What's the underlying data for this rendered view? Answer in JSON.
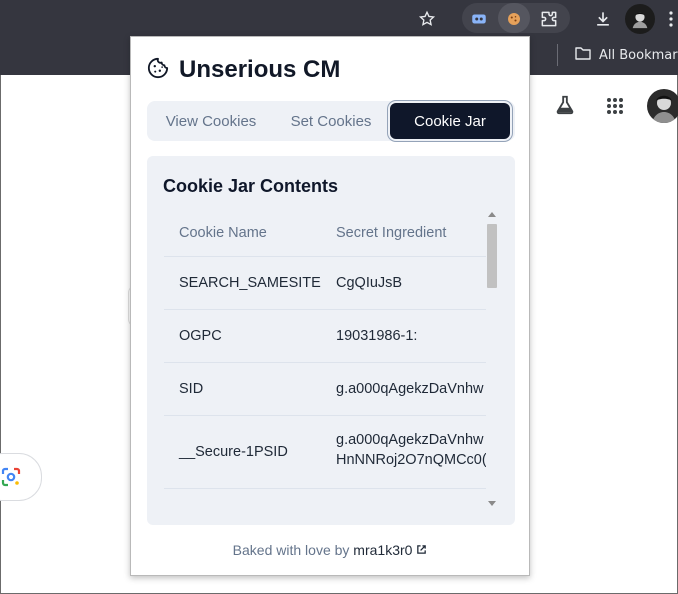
{
  "browser": {
    "bookmarks_label": "All Bookmarks"
  },
  "popup": {
    "title": "Unserious CM",
    "tabs": [
      {
        "label": "View Cookies",
        "active": false
      },
      {
        "label": "Set Cookies",
        "active": false
      },
      {
        "label": "Cookie Jar",
        "active": true
      }
    ],
    "card_title": "Cookie Jar Contents",
    "table": {
      "headers": [
        "Cookie Name",
        "Secret Ingredient"
      ],
      "rows": [
        {
          "name": "SEARCH_SAMESITE",
          "value": "CgQIuJsB"
        },
        {
          "name": "OGPC",
          "value": "19031986-1:"
        },
        {
          "name": "SID",
          "value": "g.a000qAgekzDaVnhw"
        },
        {
          "name": "__Secure-1PSID",
          "value": "g.a000qAgekzDaVnhw\nHnNNRoj2O7nQMCc0("
        }
      ]
    },
    "footer": {
      "text": "Baked with love by",
      "link": "mra1k3r0"
    }
  },
  "colors": {
    "chrome_bg": "#35363f",
    "accent": "#0f172a",
    "card_bg": "#eef1f6",
    "muted_text": "#64748b"
  }
}
